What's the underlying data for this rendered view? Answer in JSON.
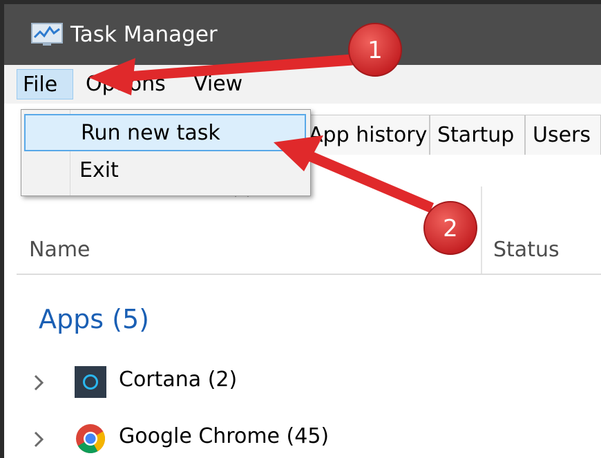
{
  "window": {
    "title": "Task Manager"
  },
  "menubar": {
    "items": [
      {
        "label": "File"
      },
      {
        "label": "Options"
      },
      {
        "label": "View"
      }
    ]
  },
  "file_menu": {
    "items": [
      {
        "label": "Run new task"
      },
      {
        "label": "Exit"
      }
    ]
  },
  "tabs": [
    {
      "label": "App history"
    },
    {
      "label": "Startup"
    },
    {
      "label": "Users"
    }
  ],
  "columns": {
    "name": "Name",
    "status": "Status"
  },
  "group": {
    "label": "Apps (5)"
  },
  "processes": [
    {
      "label": "Cortana (2)",
      "icon": "cortana-icon"
    },
    {
      "label": "Google Chrome (45)",
      "icon": "chrome-icon"
    }
  ],
  "annotations": [
    {
      "label": "1"
    },
    {
      "label": "2"
    }
  ],
  "colors": {
    "titlebar": "#4c4c4c",
    "menu_highlight": "#cce4f7",
    "group_heading": "#1a5fb4",
    "annotation_red": "#e0292b"
  }
}
